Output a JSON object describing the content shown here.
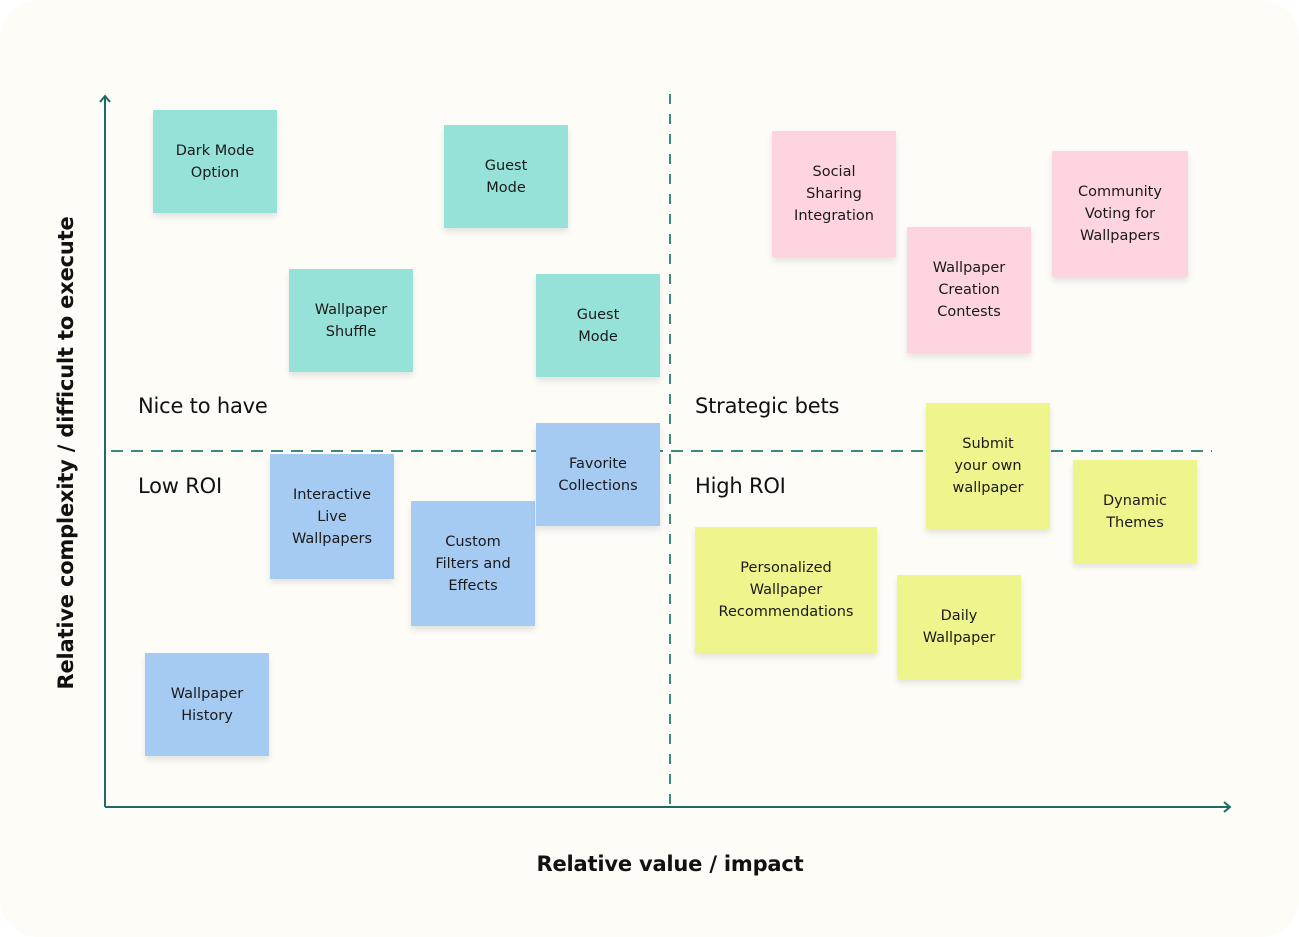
{
  "axes": {
    "x_title": "Relative value / impact",
    "y_title": "Relative complexity / difficult to execute",
    "axis_color": "#1d6b64",
    "divider_color": "#3a8a80"
  },
  "quadrants": {
    "top_left": "Nice to have",
    "bottom_left": "Low ROI",
    "top_right": "Strategic bets",
    "bottom_right": "High ROI"
  },
  "colors": {
    "teal": "#96e2d8",
    "blue": "#a6cbf3",
    "pink": "#fed5df",
    "yellow": "#eef58c",
    "board": "#fdfcf7"
  },
  "stickies": [
    {
      "text": "Dark Mode\nOption",
      "quadrant": "Nice to have",
      "color": "teal"
    },
    {
      "text": "Guest\nMode",
      "quadrant": "Nice to have",
      "color": "teal"
    },
    {
      "text": "Wallpaper\nShuffle",
      "quadrant": "Nice to have",
      "color": "teal"
    },
    {
      "text": "Guest\nMode",
      "quadrant": "Nice to have",
      "color": "teal"
    },
    {
      "text": "Favorite\nCollections",
      "quadrant": "Low ROI",
      "color": "blue"
    },
    {
      "text": "Interactive\nLive\nWallpapers",
      "quadrant": "Low ROI",
      "color": "blue"
    },
    {
      "text": "Custom\nFilters and\nEffects",
      "quadrant": "Low ROI",
      "color": "blue"
    },
    {
      "text": "Wallpaper\nHistory",
      "quadrant": "Low ROI",
      "color": "blue"
    },
    {
      "text": "Social\nSharing\nIntegration",
      "quadrant": "Strategic bets",
      "color": "pink"
    },
    {
      "text": "Wallpaper\nCreation\nContests",
      "quadrant": "Strategic bets",
      "color": "pink"
    },
    {
      "text": "Community\nVoting for\nWallpapers",
      "quadrant": "Strategic bets",
      "color": "pink"
    },
    {
      "text": "Submit\nyour own\nwallpaper",
      "quadrant": "High ROI",
      "color": "yellow"
    },
    {
      "text": "Dynamic\nThemes",
      "quadrant": "High ROI",
      "color": "yellow"
    },
    {
      "text": "Personalized\nWallpaper\nRecommendations",
      "quadrant": "High ROI",
      "color": "yellow"
    },
    {
      "text": "Daily\nWallpaper",
      "quadrant": "High ROI",
      "color": "yellow"
    }
  ]
}
